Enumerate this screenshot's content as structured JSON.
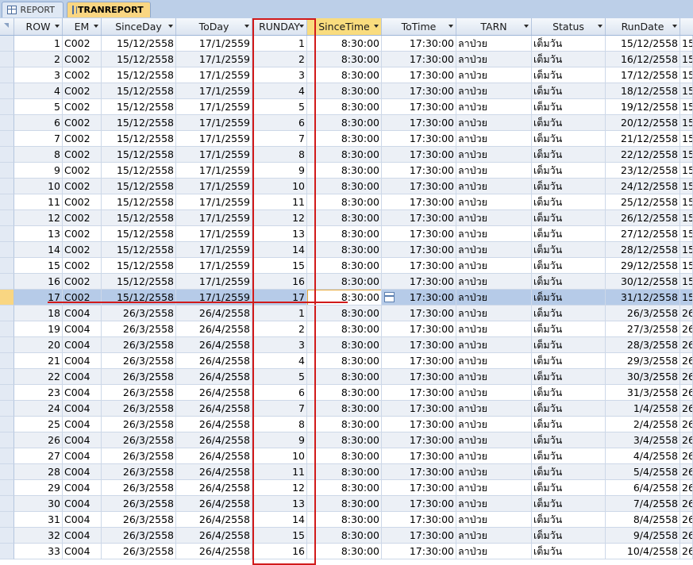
{
  "tabs": [
    {
      "label": "REPORT",
      "active": false
    },
    {
      "label": "TRANREPORT",
      "active": true
    }
  ],
  "columns": [
    "ROW",
    "EM",
    "SinceDay",
    "ToDay",
    "RUNDAY",
    "SinceTime",
    "ToTime",
    "TARN",
    "Status",
    "RunDate",
    ""
  ],
  "active_column": "SinceTime",
  "selected_row": 17,
  "rows": [
    {
      "row": "1",
      "em": "C002",
      "since_day": "15/12/2558",
      "to_day": "17/1/2559",
      "runday": "1",
      "since_time": "8:30:00",
      "to_time": "17:30:00",
      "tarn": "ลาป่วย",
      "status": "เต็มวัน",
      "run_date": "15/12/2558",
      "extra": "15"
    },
    {
      "row": "2",
      "em": "C002",
      "since_day": "15/12/2558",
      "to_day": "17/1/2559",
      "runday": "2",
      "since_time": "8:30:00",
      "to_time": "17:30:00",
      "tarn": "ลาป่วย",
      "status": "เต็มวัน",
      "run_date": "16/12/2558",
      "extra": "15"
    },
    {
      "row": "3",
      "em": "C002",
      "since_day": "15/12/2558",
      "to_day": "17/1/2559",
      "runday": "3",
      "since_time": "8:30:00",
      "to_time": "17:30:00",
      "tarn": "ลาป่วย",
      "status": "เต็มวัน",
      "run_date": "17/12/2558",
      "extra": "15"
    },
    {
      "row": "4",
      "em": "C002",
      "since_day": "15/12/2558",
      "to_day": "17/1/2559",
      "runday": "4",
      "since_time": "8:30:00",
      "to_time": "17:30:00",
      "tarn": "ลาป่วย",
      "status": "เต็มวัน",
      "run_date": "18/12/2558",
      "extra": "15"
    },
    {
      "row": "5",
      "em": "C002",
      "since_day": "15/12/2558",
      "to_day": "17/1/2559",
      "runday": "5",
      "since_time": "8:30:00",
      "to_time": "17:30:00",
      "tarn": "ลาป่วย",
      "status": "เต็มวัน",
      "run_date": "19/12/2558",
      "extra": "15"
    },
    {
      "row": "6",
      "em": "C002",
      "since_day": "15/12/2558",
      "to_day": "17/1/2559",
      "runday": "6",
      "since_time": "8:30:00",
      "to_time": "17:30:00",
      "tarn": "ลาป่วย",
      "status": "เต็มวัน",
      "run_date": "20/12/2558",
      "extra": "15"
    },
    {
      "row": "7",
      "em": "C002",
      "since_day": "15/12/2558",
      "to_day": "17/1/2559",
      "runday": "7",
      "since_time": "8:30:00",
      "to_time": "17:30:00",
      "tarn": "ลาป่วย",
      "status": "เต็มวัน",
      "run_date": "21/12/2558",
      "extra": "15"
    },
    {
      "row": "8",
      "em": "C002",
      "since_day": "15/12/2558",
      "to_day": "17/1/2559",
      "runday": "8",
      "since_time": "8:30:00",
      "to_time": "17:30:00",
      "tarn": "ลาป่วย",
      "status": "เต็มวัน",
      "run_date": "22/12/2558",
      "extra": "15"
    },
    {
      "row": "9",
      "em": "C002",
      "since_day": "15/12/2558",
      "to_day": "17/1/2559",
      "runday": "9",
      "since_time": "8:30:00",
      "to_time": "17:30:00",
      "tarn": "ลาป่วย",
      "status": "เต็มวัน",
      "run_date": "23/12/2558",
      "extra": "15"
    },
    {
      "row": "10",
      "em": "C002",
      "since_day": "15/12/2558",
      "to_day": "17/1/2559",
      "runday": "10",
      "since_time": "8:30:00",
      "to_time": "17:30:00",
      "tarn": "ลาป่วย",
      "status": "เต็มวัน",
      "run_date": "24/12/2558",
      "extra": "15"
    },
    {
      "row": "11",
      "em": "C002",
      "since_day": "15/12/2558",
      "to_day": "17/1/2559",
      "runday": "11",
      "since_time": "8:30:00",
      "to_time": "17:30:00",
      "tarn": "ลาป่วย",
      "status": "เต็มวัน",
      "run_date": "25/12/2558",
      "extra": "15"
    },
    {
      "row": "12",
      "em": "C002",
      "since_day": "15/12/2558",
      "to_day": "17/1/2559",
      "runday": "12",
      "since_time": "8:30:00",
      "to_time": "17:30:00",
      "tarn": "ลาป่วย",
      "status": "เต็มวัน",
      "run_date": "26/12/2558",
      "extra": "15"
    },
    {
      "row": "13",
      "em": "C002",
      "since_day": "15/12/2558",
      "to_day": "17/1/2559",
      "runday": "13",
      "since_time": "8:30:00",
      "to_time": "17:30:00",
      "tarn": "ลาป่วย",
      "status": "เต็มวัน",
      "run_date": "27/12/2558",
      "extra": "15"
    },
    {
      "row": "14",
      "em": "C002",
      "since_day": "15/12/2558",
      "to_day": "17/1/2559",
      "runday": "14",
      "since_time": "8:30:00",
      "to_time": "17:30:00",
      "tarn": "ลาป่วย",
      "status": "เต็มวัน",
      "run_date": "28/12/2558",
      "extra": "15"
    },
    {
      "row": "15",
      "em": "C002",
      "since_day": "15/12/2558",
      "to_day": "17/1/2559",
      "runday": "15",
      "since_time": "8:30:00",
      "to_time": "17:30:00",
      "tarn": "ลาป่วย",
      "status": "เต็มวัน",
      "run_date": "29/12/2558",
      "extra": "15"
    },
    {
      "row": "16",
      "em": "C002",
      "since_day": "15/12/2558",
      "to_day": "17/1/2559",
      "runday": "16",
      "since_time": "8:30:00",
      "to_time": "17:30:00",
      "tarn": "ลาป่วย",
      "status": "เต็มวัน",
      "run_date": "30/12/2558",
      "extra": "15"
    },
    {
      "row": "17",
      "em": "C002",
      "since_day": "15/12/2558",
      "to_day": "17/1/2559",
      "runday": "17",
      "since_time": "8:30:00",
      "to_time": "17:30:00",
      "tarn": "ลาป่วย",
      "status": "เต็มวัน",
      "run_date": "31/12/2558",
      "extra": "15"
    },
    {
      "row": "18",
      "em": "C004",
      "since_day": "26/3/2558",
      "to_day": "26/4/2558",
      "runday": "1",
      "since_time": "8:30:00",
      "to_time": "17:30:00",
      "tarn": "ลาป่วย",
      "status": "เต็มวัน",
      "run_date": "26/3/2558",
      "extra": "26"
    },
    {
      "row": "19",
      "em": "C004",
      "since_day": "26/3/2558",
      "to_day": "26/4/2558",
      "runday": "2",
      "since_time": "8:30:00",
      "to_time": "17:30:00",
      "tarn": "ลาป่วย",
      "status": "เต็มวัน",
      "run_date": "27/3/2558",
      "extra": "26"
    },
    {
      "row": "20",
      "em": "C004",
      "since_day": "26/3/2558",
      "to_day": "26/4/2558",
      "runday": "3",
      "since_time": "8:30:00",
      "to_time": "17:30:00",
      "tarn": "ลาป่วย",
      "status": "เต็มวัน",
      "run_date": "28/3/2558",
      "extra": "26"
    },
    {
      "row": "21",
      "em": "C004",
      "since_day": "26/3/2558",
      "to_day": "26/4/2558",
      "runday": "4",
      "since_time": "8:30:00",
      "to_time": "17:30:00",
      "tarn": "ลาป่วย",
      "status": "เต็มวัน",
      "run_date": "29/3/2558",
      "extra": "26"
    },
    {
      "row": "22",
      "em": "C004",
      "since_day": "26/3/2558",
      "to_day": "26/4/2558",
      "runday": "5",
      "since_time": "8:30:00",
      "to_time": "17:30:00",
      "tarn": "ลาป่วย",
      "status": "เต็มวัน",
      "run_date": "30/3/2558",
      "extra": "26"
    },
    {
      "row": "23",
      "em": "C004",
      "since_day": "26/3/2558",
      "to_day": "26/4/2558",
      "runday": "6",
      "since_time": "8:30:00",
      "to_time": "17:30:00",
      "tarn": "ลาป่วย",
      "status": "เต็มวัน",
      "run_date": "31/3/2558",
      "extra": "26"
    },
    {
      "row": "24",
      "em": "C004",
      "since_day": "26/3/2558",
      "to_day": "26/4/2558",
      "runday": "7",
      "since_time": "8:30:00",
      "to_time": "17:30:00",
      "tarn": "ลาป่วย",
      "status": "เต็มวัน",
      "run_date": "1/4/2558",
      "extra": "26"
    },
    {
      "row": "25",
      "em": "C004",
      "since_day": "26/3/2558",
      "to_day": "26/4/2558",
      "runday": "8",
      "since_time": "8:30:00",
      "to_time": "17:30:00",
      "tarn": "ลาป่วย",
      "status": "เต็มวัน",
      "run_date": "2/4/2558",
      "extra": "26"
    },
    {
      "row": "26",
      "em": "C004",
      "since_day": "26/3/2558",
      "to_day": "26/4/2558",
      "runday": "9",
      "since_time": "8:30:00",
      "to_time": "17:30:00",
      "tarn": "ลาป่วย",
      "status": "เต็มวัน",
      "run_date": "3/4/2558",
      "extra": "26"
    },
    {
      "row": "27",
      "em": "C004",
      "since_day": "26/3/2558",
      "to_day": "26/4/2558",
      "runday": "10",
      "since_time": "8:30:00",
      "to_time": "17:30:00",
      "tarn": "ลาป่วย",
      "status": "เต็มวัน",
      "run_date": "4/4/2558",
      "extra": "26"
    },
    {
      "row": "28",
      "em": "C004",
      "since_day": "26/3/2558",
      "to_day": "26/4/2558",
      "runday": "11",
      "since_time": "8:30:00",
      "to_time": "17:30:00",
      "tarn": "ลาป่วย",
      "status": "เต็มวัน",
      "run_date": "5/4/2558",
      "extra": "26"
    },
    {
      "row": "29",
      "em": "C004",
      "since_day": "26/3/2558",
      "to_day": "26/4/2558",
      "runday": "12",
      "since_time": "8:30:00",
      "to_time": "17:30:00",
      "tarn": "ลาป่วย",
      "status": "เต็มวัน",
      "run_date": "6/4/2558",
      "extra": "26"
    },
    {
      "row": "30",
      "em": "C004",
      "since_day": "26/3/2558",
      "to_day": "26/4/2558",
      "runday": "13",
      "since_time": "8:30:00",
      "to_time": "17:30:00",
      "tarn": "ลาป่วย",
      "status": "เต็มวัน",
      "run_date": "7/4/2558",
      "extra": "26"
    },
    {
      "row": "31",
      "em": "C004",
      "since_day": "26/3/2558",
      "to_day": "26/4/2558",
      "runday": "14",
      "since_time": "8:30:00",
      "to_time": "17:30:00",
      "tarn": "ลาป่วย",
      "status": "เต็มวัน",
      "run_date": "8/4/2558",
      "extra": "26"
    },
    {
      "row": "32",
      "em": "C004",
      "since_day": "26/3/2558",
      "to_day": "26/4/2558",
      "runday": "15",
      "since_time": "8:30:00",
      "to_time": "17:30:00",
      "tarn": "ลาป่วย",
      "status": "เต็มวัน",
      "run_date": "9/4/2558",
      "extra": "26"
    },
    {
      "row": "33",
      "em": "C004",
      "since_day": "26/3/2558",
      "to_day": "26/4/2558",
      "runday": "16",
      "since_time": "8:30:00",
      "to_time": "17:30:00",
      "tarn": "ลาป่วย",
      "status": "เต็มวัน",
      "run_date": "10/4/2558",
      "extra": "26"
    }
  ],
  "colors": {
    "selected_row": "#b6cbe8",
    "active_tab": "#f9d682",
    "annotation": "#d11a1a"
  }
}
